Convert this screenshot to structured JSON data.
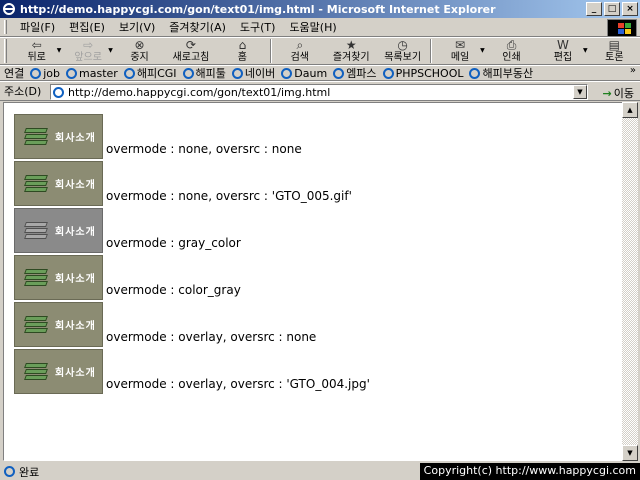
{
  "window": {
    "title": "http://demo.happycgi.com/gon/text01/img.html - Microsoft Internet Explorer",
    "min": "_",
    "max": "□",
    "close": "×"
  },
  "menu": [
    "파일(F)",
    "편집(E)",
    "보기(V)",
    "즐겨찾기(A)",
    "도구(T)",
    "도움말(H)"
  ],
  "toolbar": [
    {
      "label": "뒤로",
      "icon": "⇦",
      "name": "back",
      "drop": true,
      "disabled": false
    },
    {
      "label": "앞으로",
      "icon": "⇨",
      "name": "forward",
      "drop": true,
      "disabled": true
    },
    {
      "label": "중지",
      "icon": "⊗",
      "name": "stop",
      "drop": false,
      "disabled": false
    },
    {
      "label": "새로고침",
      "icon": "⟳",
      "name": "refresh",
      "drop": false,
      "disabled": false
    },
    {
      "label": "홈",
      "icon": "⌂",
      "name": "home",
      "drop": false,
      "disabled": false
    },
    {
      "label": "검색",
      "icon": "⌕",
      "name": "search",
      "drop": false,
      "disabled": false
    },
    {
      "label": "즐겨찾기",
      "icon": "★",
      "name": "favorites",
      "drop": false,
      "disabled": false
    },
    {
      "label": "목록보기",
      "icon": "◷",
      "name": "history",
      "drop": false,
      "disabled": false
    },
    {
      "label": "메일",
      "icon": "✉",
      "name": "mail",
      "drop": true,
      "disabled": false
    },
    {
      "label": "인쇄",
      "icon": "⎙",
      "name": "print",
      "drop": false,
      "disabled": false
    },
    {
      "label": "편집",
      "icon": "W",
      "name": "edit",
      "drop": true,
      "disabled": false
    },
    {
      "label": "토론",
      "icon": "▤",
      "name": "discuss",
      "drop": false,
      "disabled": false
    }
  ],
  "links": {
    "lead": "연결",
    "items": [
      "job",
      "master",
      "해피CGI",
      "해피툴",
      "네이버",
      "Daum",
      "엠파스",
      "PHPSCHOOL",
      "해피부동산"
    ],
    "more": "»"
  },
  "address": {
    "label": "주소(D)",
    "url": "http://demo.happycgi.com/gon/text01/img.html",
    "drop": "▼",
    "go": "이동",
    "go_icon": "→"
  },
  "content": {
    "button_text": "회사소개",
    "rows": [
      {
        "text": "overmode : none, oversrc : none",
        "gray": false
      },
      {
        "text": "overmode : none, oversrc : 'GTO_005.gif'",
        "gray": false
      },
      {
        "text": "overmode : gray_color",
        "gray": true
      },
      {
        "text": "overmode : color_gray",
        "gray": false
      },
      {
        "text": "overmode : overlay, oversrc : none",
        "gray": false
      },
      {
        "text": "overmode : overlay, oversrc : 'GTO_004.jpg'",
        "gray": false
      }
    ]
  },
  "scroll": {
    "up": "▲",
    "down": "▼"
  },
  "status": {
    "text": "완료",
    "copyright": "Copyright(c) http://www.happycgi.com"
  }
}
